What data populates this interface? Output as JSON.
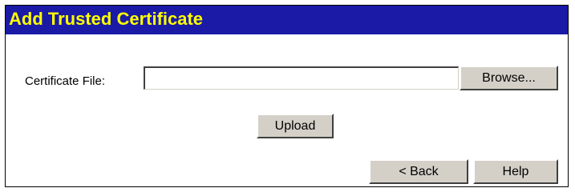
{
  "header": {
    "title": "Add Trusted Certificate"
  },
  "form": {
    "certificate_file_label": "Certificate File:",
    "certificate_file_value": "",
    "certificate_file_placeholder": ""
  },
  "buttons": {
    "browse_label": "Browse...",
    "upload_label": "Upload",
    "back_label": "< Back",
    "help_label": "Help"
  },
  "colors": {
    "title_bar_background": "#1a1aa6",
    "title_text": "#ffff00",
    "button_face": "#d4d0c8"
  }
}
